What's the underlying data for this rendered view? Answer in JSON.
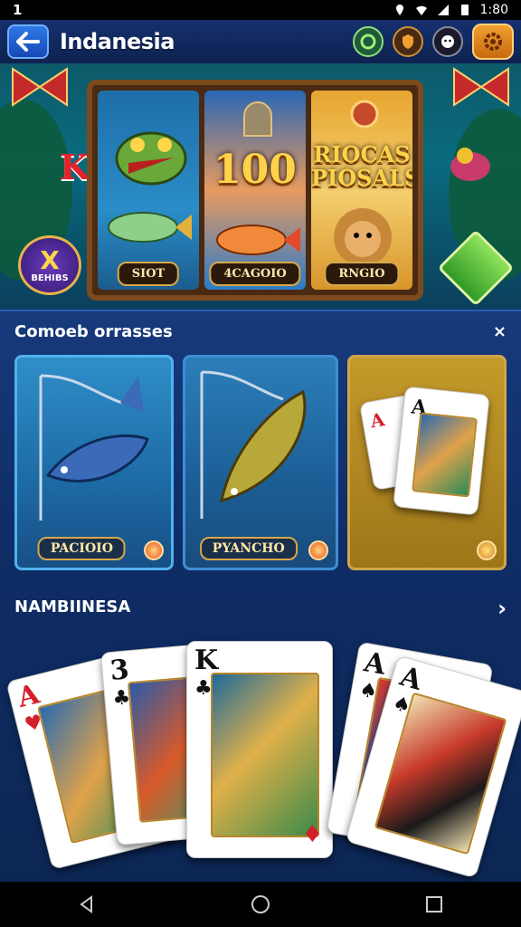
{
  "status_bar": {
    "left_text": "1",
    "time": "1:80"
  },
  "header": {
    "title": "Indanesia",
    "back_icon": "arrow-left-icon"
  },
  "banner": {
    "side_card_letter": "K",
    "badge_symbol": "X",
    "badge_label": "BEHIBS",
    "reels": [
      {
        "label": "SIOT",
        "big_text": ""
      },
      {
        "label": "4CAGOIO",
        "big_text": "100"
      },
      {
        "label": "RNGIO",
        "big_text": "RIOCAS PIOSALS"
      }
    ]
  },
  "section1": {
    "title": "Comoeb orrasses",
    "close_label": "×",
    "cards": [
      {
        "label": "PACIOIO"
      },
      {
        "label": "PYANCHO"
      },
      {
        "label": ""
      }
    ]
  },
  "section2": {
    "title": "NAMBIINESA",
    "more_label": "›",
    "cards": [
      {
        "rank": "A",
        "suit": "♥",
        "color": "red"
      },
      {
        "rank": "3",
        "suit": "♣",
        "color": "black"
      },
      {
        "rank": "K",
        "suit": "♣",
        "color": "black"
      },
      {
        "rank": "A",
        "suit": "♠",
        "color": "black"
      },
      {
        "rank": "A",
        "suit": "♠",
        "color": "black"
      }
    ]
  },
  "colors": {
    "panel_bg": "#0f2d66",
    "accent_gold": "#d7a84a",
    "header_bg": "#16306e"
  }
}
